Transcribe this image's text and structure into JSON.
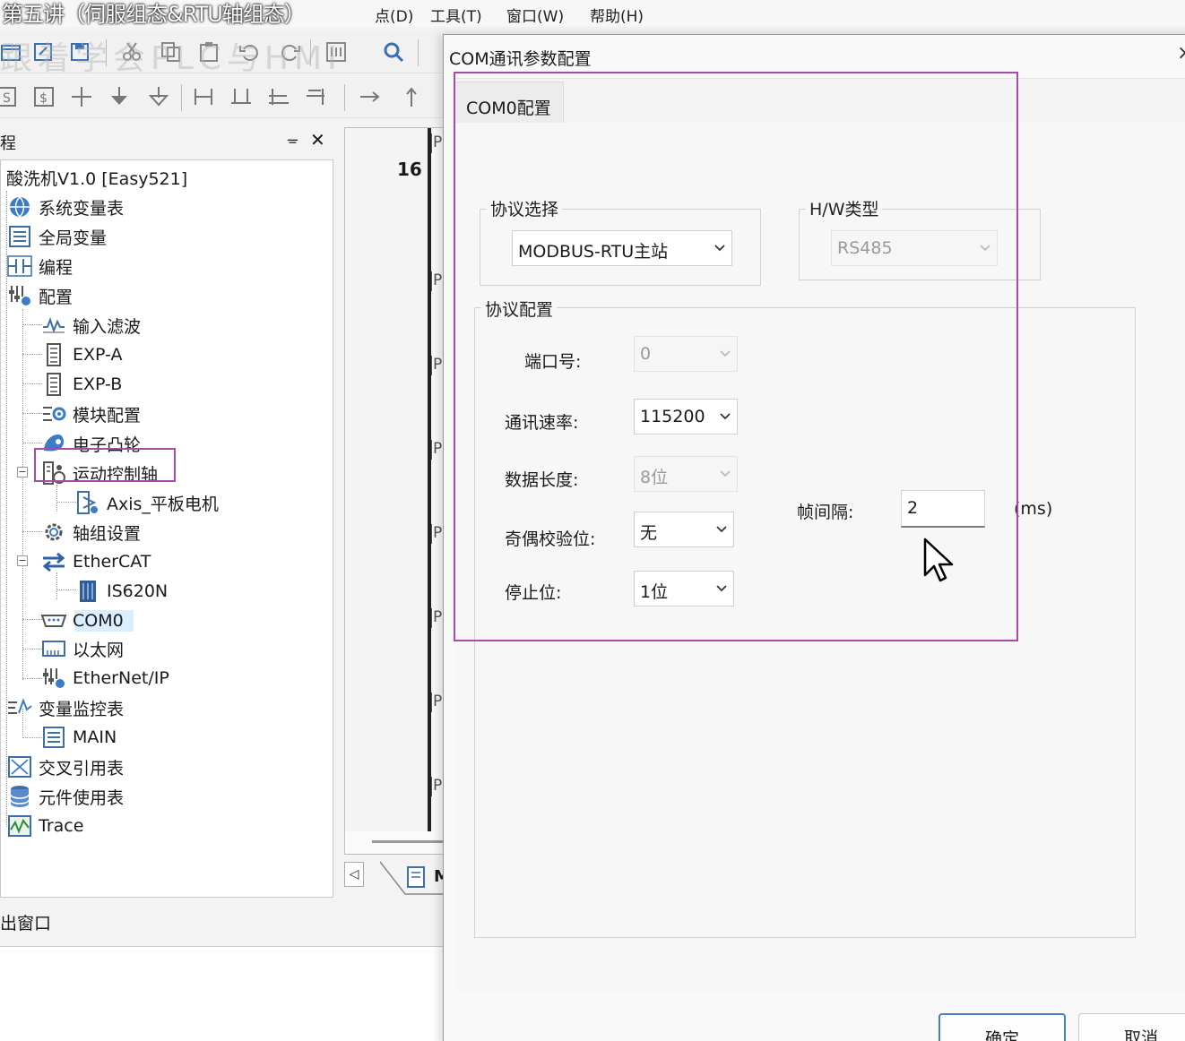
{
  "video_title": "第五讲（伺服组态&RTU轴组态）",
  "menubar": {
    "items": [
      "点(D)",
      "工具(T)",
      "窗口(W)",
      "帮助(H)"
    ]
  },
  "watermark": "跟着学会PLC与HMI",
  "project_panel": {
    "title": "程",
    "pin": "ᚚ",
    "close": "✕",
    "items": [
      {
        "label": "酸洗机V1.0 [Easy521]",
        "icon": "project-root-icon"
      },
      {
        "label": "系统变量表",
        "icon": "globe-icon"
      },
      {
        "label": "全局变量",
        "icon": "table-icon"
      },
      {
        "label": "编程",
        "icon": "ladder-icon"
      },
      {
        "label": "配置",
        "icon": "config-icon"
      },
      {
        "label": "输入滤波",
        "icon": "filter-wave-icon"
      },
      {
        "label": "EXP-A",
        "icon": "module-icon"
      },
      {
        "label": "EXP-B",
        "icon": "module-icon"
      },
      {
        "label": "模块配置",
        "icon": "module-config-icon"
      },
      {
        "label": "电子凸轮",
        "icon": "cam-icon"
      },
      {
        "label": "运动控制轴",
        "icon": "axis-icon"
      },
      {
        "label": "Axis_平板电机",
        "icon": "axis-item-icon"
      },
      {
        "label": "轴组设置",
        "icon": "gear-icon"
      },
      {
        "label": "EtherCAT",
        "icon": "ethercat-icon"
      },
      {
        "label": "IS620N",
        "icon": "servo-drive-icon"
      },
      {
        "label": "COM0",
        "icon": "serial-port-icon"
      },
      {
        "label": "以太网",
        "icon": "ethernet-icon"
      },
      {
        "label": "EtherNet/IP",
        "icon": "config-icon"
      },
      {
        "label": "变量监控表",
        "icon": "monitor-icon"
      },
      {
        "label": "MAIN",
        "icon": "table-icon"
      },
      {
        "label": "交叉引用表",
        "icon": "cross-ref-icon"
      },
      {
        "label": "元件使用表",
        "icon": "database-icon"
      },
      {
        "label": "Trace",
        "icon": "trace-icon"
      }
    ]
  },
  "output_panel": {
    "title": "出窗口"
  },
  "editor": {
    "line_number": "16",
    "row_marker": "P",
    "tab_label": "M",
    "scroll_left": "◁"
  },
  "dialog": {
    "title": "COM通讯参数配置",
    "close": "×",
    "tab_label": "COM0配置",
    "protocol_group": {
      "title": "协议选择",
      "value": "MODBUS-RTU主站"
    },
    "hw_group": {
      "title": "H/W类型",
      "value": "RS485"
    },
    "config_group": {
      "title": "协议配置",
      "port_label": "端口号:",
      "port_value": "0",
      "baud_label": "通讯速率:",
      "baud_value": "115200",
      "datalen_label": "数据长度:",
      "datalen_value": "8位",
      "parity_label": "奇偶校验位:",
      "parity_value": "无",
      "stop_label": "停止位:",
      "stop_value": "1位",
      "frame_label": "帧间隔:",
      "frame_value": "2",
      "frame_unit": "(ms)"
    },
    "ok_button": "确定",
    "cancel_button": "取消"
  },
  "colors": {
    "highlight_box": "#a64ba9",
    "selection": "#dbeeff",
    "primary_border": "#4a7cc9"
  }
}
